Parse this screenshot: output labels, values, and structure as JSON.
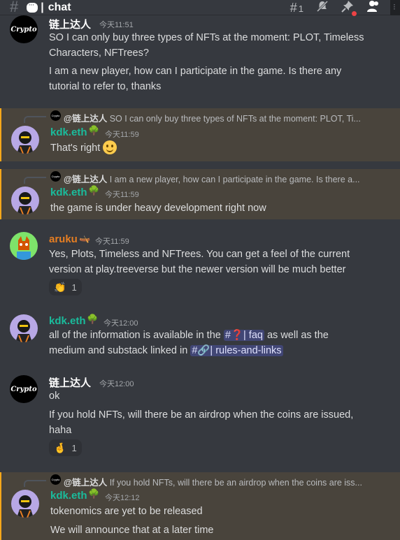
{
  "header": {
    "hash": "#",
    "channel_sep": "|",
    "channel_name": "chat",
    "threads_count": "1"
  },
  "users": {
    "crypto": {
      "name": "链上达人",
      "avatar_text": "Crypto"
    },
    "kdk": {
      "name": "kdk.eth"
    },
    "aruku": {
      "name": "aruku"
    }
  },
  "messages": {
    "m1": {
      "timestamp": "今天11:51",
      "line1": "SO I can only buy three types of NFTs at the moment: PLOT, Timeless",
      "line2": "Characters, NFTrees?",
      "line3": "I am a new player, how can I participate in the game. Is there any",
      "line4": "tutorial to refer to, thanks"
    },
    "m2": {
      "reply_at": "@链上达人",
      "reply_text": "SO I can only buy three types of NFTs at the moment: PLOT, Ti...",
      "timestamp": "今天11:59",
      "text": "That's right"
    },
    "m3": {
      "reply_at": "@链上达人",
      "reply_text": "I am a new player, how can I participate in the game. Is there a...",
      "timestamp": "今天11:59",
      "text": "the game is under heavy development right now"
    },
    "m4": {
      "timestamp": "今天11:59",
      "line1": "Yes, Plots, Timeless and NFTrees. You can get a feel of the current",
      "line2": "version at play.treeverse but the newer version will be much better",
      "reaction_count": "1"
    },
    "m5": {
      "timestamp": "今天12:00",
      "line1_a": "all of the information is available in the",
      "chan1": "#❓| faq",
      "line1_b": "as well as the",
      "line2_a": "medium and substack linked in",
      "chan2": "#🔗| rules-and-links"
    },
    "m6": {
      "timestamp": "今天12:00",
      "line1": "ok",
      "line2": "If you hold NFTs, will there be an airdrop when the coins are issued,",
      "line3": "haha",
      "reaction_count": "1"
    },
    "m7": {
      "reply_at": "@链上达人",
      "reply_text": "If you hold NFTs, will there be an airdrop when the coins are iss...",
      "timestamp": "今天12:12",
      "line1": "tokenomics are yet to be released",
      "line2": "We will announce that at a later time"
    }
  },
  "colors": {
    "background": "#36393f",
    "mention_bg": "#49443c",
    "mention_border": "#faa81a",
    "teal_name": "#1abc9c",
    "orange_name": "#e67e22"
  }
}
